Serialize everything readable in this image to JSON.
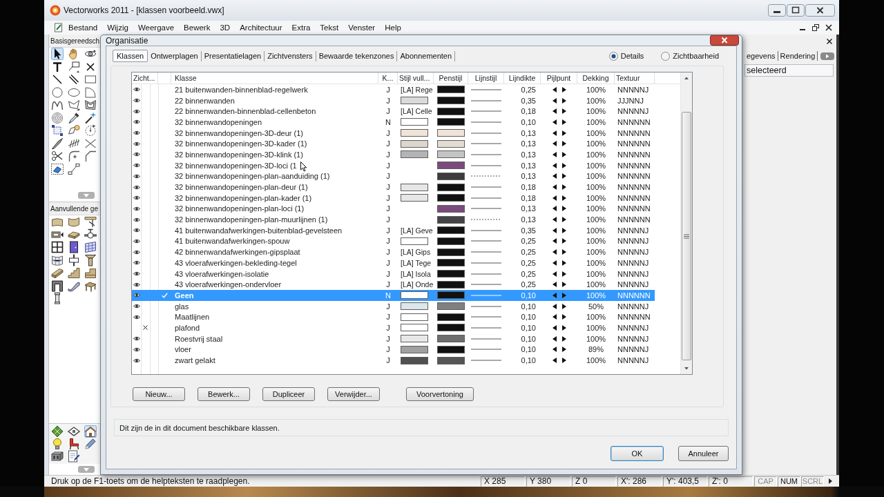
{
  "window": {
    "title": "Vectorworks 2011 - [klassen voorbeeld.vwx]"
  },
  "menu": [
    "Bestand",
    "Wijzig",
    "Weergave",
    "Bewerk",
    "3D",
    "Architectuur",
    "Extra",
    "Tekst",
    "Venster",
    "Help"
  ],
  "palettes": [
    {
      "title": "Basisgereedsch",
      "tools": [
        {
          "kind": "pointer",
          "selected": true
        },
        {
          "kind": "hand",
          "selected": false
        },
        {
          "kind": "flyover",
          "selected": false
        },
        {
          "kind": "text",
          "selected": false
        },
        {
          "kind": "callout",
          "selected": false
        },
        {
          "kind": "locus",
          "selected": false
        },
        {
          "kind": "line",
          "selected": false
        },
        {
          "kind": "doubleline",
          "selected": false
        },
        {
          "kind": "rectangle",
          "selected": false
        },
        {
          "kind": "circle",
          "selected": false
        },
        {
          "kind": "oval",
          "selected": false
        },
        {
          "kind": "arc",
          "selected": false
        },
        {
          "kind": "polyline",
          "selected": false
        },
        {
          "kind": "polygon",
          "selected": false
        },
        {
          "kind": "doublepolygon",
          "selected": false
        },
        {
          "kind": "spiral",
          "selected": false
        },
        {
          "kind": "eyedropper",
          "selected": false
        },
        {
          "kind": "wand",
          "selected": false
        },
        {
          "kind": "clip",
          "selected": false
        },
        {
          "kind": "reshape",
          "selected": false
        },
        {
          "kind": "rotate",
          "selected": false
        },
        {
          "kind": "blade",
          "selected": false
        },
        {
          "kind": "hatch",
          "selected": false
        },
        {
          "kind": "mirror",
          "selected": false
        },
        {
          "kind": "trim",
          "selected": false
        },
        {
          "kind": "fillet",
          "selected": false
        },
        {
          "kind": "chamfer",
          "selected": false
        },
        {
          "kind": "eraser",
          "selected": false
        },
        {
          "kind": "connector",
          "selected": false
        }
      ]
    },
    {
      "title": "Aanvullende ge",
      "tools": [
        {
          "kind": "wall",
          "selected": false
        },
        {
          "kind": "roundwall",
          "selected": false
        },
        {
          "kind": "bracket",
          "selected": false
        },
        {
          "kind": "frame",
          "selected": false
        },
        {
          "kind": "slab",
          "selected": false
        },
        {
          "kind": "valve",
          "selected": false
        },
        {
          "kind": "window",
          "selected": false
        },
        {
          "kind": "door",
          "selected": false
        },
        {
          "kind": "curtainwall",
          "selected": false
        },
        {
          "kind": "curvedgrid",
          "selected": false
        },
        {
          "kind": "joint",
          "selected": false
        },
        {
          "kind": "capital",
          "selected": false
        },
        {
          "kind": "beam",
          "selected": false
        },
        {
          "kind": "stairs",
          "selected": false
        },
        {
          "kind": "step",
          "selected": false
        },
        {
          "kind": "arch",
          "selected": false
        },
        {
          "kind": "escalator",
          "selected": false
        },
        {
          "kind": "deck",
          "selected": false
        },
        {
          "kind": "pillar",
          "selected": false
        }
      ]
    }
  ],
  "tool_sets": [
    {
      "kind": "grid",
      "selected": false
    },
    {
      "kind": "diamond",
      "selected": false
    },
    {
      "kind": "house",
      "selected": true
    },
    {
      "kind": "bulb",
      "selected": false
    },
    {
      "kind": "chair",
      "selected": false
    },
    {
      "kind": "pencil",
      "selected": false
    },
    {
      "kind": "block",
      "selected": false
    },
    {
      "kind": "document",
      "selected": false
    }
  ],
  "info_panel": {
    "tabs": [
      "egevens",
      "Rendering"
    ],
    "value": "selecteerd"
  },
  "dialog": {
    "title": "Organisatie",
    "tabs": [
      {
        "label": "Klassen",
        "selected": true
      },
      {
        "label": "Ontwerplagen",
        "selected": false
      },
      {
        "label": "Presentatielagen",
        "selected": false
      },
      {
        "label": "Zichtvensters",
        "selected": false
      },
      {
        "label": "Bewaarde tekenzones",
        "selected": false
      },
      {
        "label": "Abonnementen",
        "selected": false
      }
    ],
    "view_options": [
      {
        "label": "Details",
        "selected": true
      },
      {
        "label": "Zichtbaarheid",
        "selected": false
      }
    ],
    "table": {
      "columns": [
        "Zicht...",
        "Klasse",
        "K...",
        "Stijl vull...",
        "Penstijl",
        "Lijnstijl",
        "Lijndikte",
        "Pijlpunt",
        "Dekking",
        "Textuur"
      ],
      "rows": [
        {
          "visible": true,
          "active": false,
          "selected": false,
          "name": "21 buitenwanden-binnenblad-regelwerk",
          "k": "J",
          "fill": {
            "kind": "label",
            "text": "[LA] Rege"
          },
          "pen": {
            "color": "#111111"
          },
          "dashed": false,
          "thickness": "0,25",
          "opacity": "100%",
          "texture": "NNNNNJ"
        },
        {
          "visible": true,
          "active": false,
          "selected": false,
          "name": "22 binnenwanden",
          "k": "J",
          "fill": {
            "kind": "swatch",
            "color": "#dadada"
          },
          "pen": {
            "color": "#111111"
          },
          "dashed": false,
          "thickness": "0,35",
          "opacity": "100%",
          "texture": "JJJNNJ"
        },
        {
          "visible": true,
          "active": false,
          "selected": false,
          "name": "22 binnenwanden-binnenblad-cellenbeton",
          "k": "J",
          "fill": {
            "kind": "label",
            "text": "[LA] Celle"
          },
          "pen": {
            "color": "#111111"
          },
          "dashed": false,
          "thickness": "0,18",
          "opacity": "100%",
          "texture": "NNNNNJ"
        },
        {
          "visible": true,
          "active": false,
          "selected": false,
          "name": "32 binnenwandopeningen",
          "k": "N",
          "fill": {
            "kind": "swatch",
            "color": "#ffffff"
          },
          "pen": {
            "color": "#111111"
          },
          "dashed": false,
          "thickness": "0,10",
          "opacity": "100%",
          "texture": "NNNNNN"
        },
        {
          "visible": true,
          "active": false,
          "selected": false,
          "name": "32 binnenwandopeningen-3D-deur (1)",
          "k": "J",
          "fill": {
            "kind": "swatch",
            "color": "#efe4d6"
          },
          "pen": {
            "color": "#efe4d6"
          },
          "dashed": false,
          "thickness": "0,13",
          "opacity": "100%",
          "texture": "NNNNNN"
        },
        {
          "visible": true,
          "active": false,
          "selected": false,
          "name": "32 binnenwandopeningen-3D-kader (1)",
          "k": "J",
          "fill": {
            "kind": "swatch",
            "color": "#dcd6cc"
          },
          "pen": {
            "color": "#e2dcd2"
          },
          "dashed": false,
          "thickness": "0,13",
          "opacity": "100%",
          "texture": "NNNNNN"
        },
        {
          "visible": true,
          "active": false,
          "selected": false,
          "name": "32 binnenwandopeningen-3D-klink (1)",
          "k": "J",
          "fill": {
            "kind": "swatch",
            "color": "#b4b4b4"
          },
          "pen": {
            "color": "#c4c4c4"
          },
          "dashed": false,
          "thickness": "0,13",
          "opacity": "100%",
          "texture": "NNNNNN"
        },
        {
          "visible": true,
          "active": false,
          "selected": false,
          "name": "32 binnenwandopeningen-3D-loci (1",
          "k": "J",
          "pen": {
            "color": "#7b4b7e"
          },
          "dashed": false,
          "thickness": "0,13",
          "opacity": "100%",
          "texture": "NNNNNN"
        },
        {
          "visible": true,
          "active": false,
          "selected": false,
          "name": "32 binnenwandopeningen-plan-aanduiding (1)",
          "k": "J",
          "pen": {
            "color": "#3c3c3c"
          },
          "dashed": true,
          "thickness": "0,13",
          "opacity": "100%",
          "texture": "NNNNNN"
        },
        {
          "visible": true,
          "active": false,
          "selected": false,
          "name": "32 binnenwandopeningen-plan-deur (1)",
          "k": "J",
          "fill": {
            "kind": "swatch",
            "color": "#e6e6e6"
          },
          "pen": {
            "color": "#111111"
          },
          "dashed": false,
          "thickness": "0,18",
          "opacity": "100%",
          "texture": "NNNNNN"
        },
        {
          "visible": true,
          "active": false,
          "selected": false,
          "name": "32 binnenwandopeningen-plan-kader (1)",
          "k": "J",
          "fill": {
            "kind": "swatch",
            "color": "#e6e6e6"
          },
          "pen": {
            "color": "#111111"
          },
          "dashed": false,
          "thickness": "0,18",
          "opacity": "100%",
          "texture": "NNNNNN"
        },
        {
          "visible": true,
          "active": false,
          "selected": false,
          "name": "32 binnenwandopeningen-plan-loci (1)",
          "k": "J",
          "pen": {
            "color": "#7b4b7e"
          },
          "dashed": false,
          "thickness": "0,13",
          "opacity": "100%",
          "texture": "NNNNNN"
        },
        {
          "visible": true,
          "active": false,
          "selected": false,
          "name": "32 binnenwandopeningen-plan-muurlijnen (1)",
          "k": "J",
          "pen": {
            "color": "#444444"
          },
          "dashed": true,
          "thickness": "0,13",
          "opacity": "100%",
          "texture": "NNNNNN"
        },
        {
          "visible": true,
          "active": false,
          "selected": false,
          "name": "41 buitenwandafwerkingen-buitenblad-gevelsteen",
          "k": "J",
          "fill": {
            "kind": "label",
            "text": "[LA] Geve"
          },
          "pen": {
            "color": "#111111"
          },
          "dashed": false,
          "thickness": "0,35",
          "opacity": "100%",
          "texture": "NNNNNJ"
        },
        {
          "visible": true,
          "active": false,
          "selected": false,
          "name": "41 buitenwandafwerkingen-spouw",
          "k": "J",
          "fill": {
            "kind": "swatch",
            "color": "#ffffff"
          },
          "pen": {
            "color": "#111111"
          },
          "dashed": false,
          "thickness": "0,25",
          "opacity": "100%",
          "texture": "NNNNNJ"
        },
        {
          "visible": true,
          "active": false,
          "selected": false,
          "name": "42 binnenwandafwerkingen-gipsplaat",
          "k": "J",
          "fill": {
            "kind": "label",
            "text": "[LA] Gips"
          },
          "pen": {
            "color": "#111111"
          },
          "dashed": false,
          "thickness": "0,25",
          "opacity": "100%",
          "texture": "NNNNNJ"
        },
        {
          "visible": true,
          "active": false,
          "selected": false,
          "name": "43 vloerafwerkingen-bekleding-tegel",
          "k": "J",
          "fill": {
            "kind": "label",
            "text": "[LA] Tege"
          },
          "pen": {
            "color": "#111111"
          },
          "dashed": false,
          "thickness": "0,25",
          "opacity": "100%",
          "texture": "NNNNNJ"
        },
        {
          "visible": true,
          "active": false,
          "selected": false,
          "name": "43 vloerafwerkingen-isolatie",
          "k": "J",
          "fill": {
            "kind": "label",
            "text": "[LA] Isola"
          },
          "pen": {
            "color": "#111111"
          },
          "dashed": false,
          "thickness": "0,25",
          "opacity": "100%",
          "texture": "NNNNNJ"
        },
        {
          "visible": true,
          "active": false,
          "selected": false,
          "name": "43 vloerafwerkingen-ondervloer",
          "k": "J",
          "fill": {
            "kind": "label",
            "text": "[LA] Onde"
          },
          "pen": {
            "color": "#111111"
          },
          "dashed": false,
          "thickness": "0,25",
          "opacity": "100%",
          "texture": "NNNNNJ"
        },
        {
          "visible": true,
          "active": true,
          "selected": true,
          "name": "Geen",
          "k": "N",
          "fill": {
            "kind": "swatch",
            "color": "#ffffff"
          },
          "pen": {
            "color": "#111111"
          },
          "dashed": false,
          "thickness": "0,10",
          "opacity": "100%",
          "texture": "NNNNNN"
        },
        {
          "visible": true,
          "active": false,
          "selected": false,
          "name": "glas",
          "k": "J",
          "fill": {
            "kind": "swatch",
            "color": "#dde6ea"
          },
          "pen": {
            "color": "#808080"
          },
          "dashed": false,
          "thickness": "0,10",
          "opacity": "50%",
          "texture": "NNNNNJ"
        },
        {
          "visible": true,
          "active": false,
          "selected": false,
          "name": "Maatlijnen",
          "k": "J",
          "fill": {
            "kind": "swatch",
            "color": "#ffffff"
          },
          "pen": {
            "color": "#111111"
          },
          "dashed": false,
          "thickness": "0,10",
          "opacity": "100%",
          "texture": "NNNNNN"
        },
        {
          "visible": false,
          "active": false,
          "selected": false,
          "name": "plafond",
          "k": "J",
          "fill": {
            "kind": "swatch",
            "color": "#ffffff"
          },
          "pen": {
            "color": "#111111"
          },
          "dashed": false,
          "thickness": "0,10",
          "opacity": "100%",
          "texture": "NNNNNJ"
        },
        {
          "visible": true,
          "active": false,
          "selected": false,
          "name": "Roestvrij staal",
          "k": "J",
          "fill": {
            "kind": "swatch",
            "color": "#e8e8e8"
          },
          "pen": {
            "color": "#6e6e6e"
          },
          "dashed": false,
          "thickness": "0,10",
          "opacity": "100%",
          "texture": "NNNNNJ"
        },
        {
          "visible": true,
          "active": false,
          "selected": false,
          "name": "vloer",
          "k": "J",
          "fill": {
            "kind": "swatch",
            "color": "#a0a0a0"
          },
          "pen": {
            "color": "#111111"
          },
          "dashed": false,
          "thickness": "0,10",
          "opacity": "89%",
          "texture": "NNNNNJ"
        },
        {
          "visible": true,
          "active": false,
          "selected": false,
          "name": "zwart gelakt",
          "k": "J",
          "fill": {
            "kind": "swatch",
            "color": "#505050"
          },
          "pen": {
            "color": "#555555"
          },
          "dashed": false,
          "thickness": "0,10",
          "opacity": "100%",
          "texture": "NNNNNJ"
        }
      ]
    },
    "buttons": [
      "Nieuw...",
      "Bewerk...",
      "Dupliceer",
      "Verwijder...",
      "Voorvertoning"
    ],
    "description": "Dit zijn de in dit document beschikbare klassen.",
    "footer_buttons": [
      {
        "label": "OK",
        "default": true
      },
      {
        "label": "Annuleer",
        "default": false
      }
    ]
  },
  "status_bar": {
    "message": "Druk op de F1-toets om de helpteksten te raadplegen.",
    "coordinates": [
      "X 285",
      "Y 380",
      "Z 0",
      "X': 286",
      "Y': 403,5",
      "Z': 0"
    ],
    "indicators": [
      {
        "label": "CAP",
        "on": false
      },
      {
        "label": "NUM",
        "on": true
      },
      {
        "label": "SCRL",
        "on": false
      }
    ]
  }
}
